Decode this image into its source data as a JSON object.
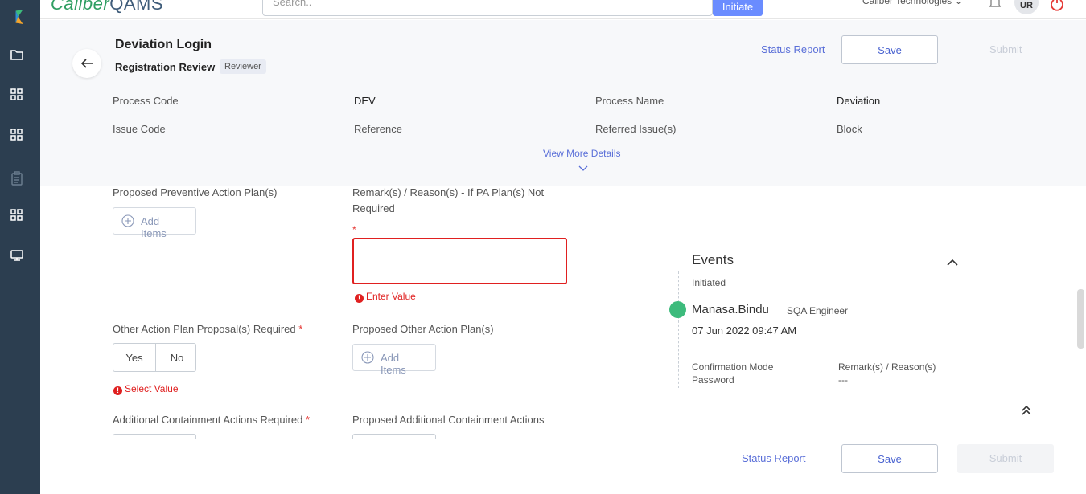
{
  "topbar": {
    "logo_main": "Caliber",
    "logo_suffix": "QAMS",
    "search_placeholder": "Search..",
    "initiate_label": "Initiate",
    "company": "Caliber Technologies",
    "avatar_initials": "UR"
  },
  "header": {
    "title": "Deviation Login",
    "subtitle": "Registration Review",
    "role_badge": "Reviewer",
    "status_report_label": "Status Report",
    "save_label": "Save",
    "submit_label": "Submit",
    "fields": [
      {
        "label": "Process Code",
        "value": "DEV"
      },
      {
        "label": "Process Name",
        "value": "Deviation"
      },
      {
        "label": "Issue Code",
        "value": ""
      },
      {
        "label": "Reference",
        "value": ""
      },
      {
        "label": "Referred Issue(s)",
        "value": ""
      },
      {
        "label": "Block",
        "value": ""
      }
    ],
    "view_more_label": "View More Details"
  },
  "form": {
    "pa_plans_label": "Proposed Preventive Action Plan(s)",
    "pa_add_items": "Add Items",
    "pa_remark_label": "Remark(s) / Reason(s) - If PA Plan(s) Not Required",
    "required_mark": "*",
    "enter_value_error": "Enter Value",
    "other_ap_label": "Other Action Plan Proposal(s) Required",
    "yes_label": "Yes",
    "no_label": "No",
    "select_value_error": "Select Value",
    "other_plans_label": "Proposed Other Action Plan(s)",
    "other_add_items": "Add Items",
    "additional_label": "Additional Containment Actions Required",
    "proposed_additional_label": "Proposed Additional Containment Actions"
  },
  "events": {
    "title": "Events",
    "stage": "Initiated",
    "user": "Manasa.Bindu",
    "role": "SQA Engineer",
    "date": "07 Jun 2022 09:47 AM",
    "confirmation_label": "Confirmation Mode",
    "confirmation_value": "Password",
    "remarks_label": "Remark(s) / Reason(s)",
    "remarks_value": "---"
  },
  "footer": {
    "status_report_label": "Status Report",
    "save_label": "Save",
    "submit_label": "Submit"
  },
  "colors": {
    "sidebar": "#2c3e50",
    "accent": "#5a6fd8",
    "error": "#e02020",
    "event_dot": "#3dbb7c"
  }
}
